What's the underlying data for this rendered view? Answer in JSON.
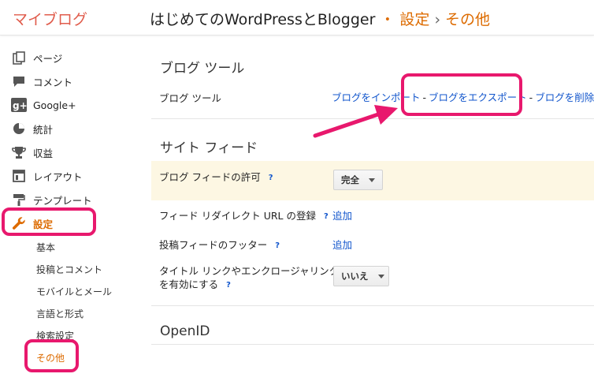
{
  "header": {
    "brand": "マイブログ",
    "blog_name": "はじめてのWordPressとBlogger",
    "sep1": "・",
    "section": "設定",
    "sep2": "›",
    "page": "その他"
  },
  "sidebar": {
    "items": [
      {
        "label": "ページ",
        "icon": "pages-icon"
      },
      {
        "label": "コメント",
        "icon": "comment-icon"
      },
      {
        "label": "Google+",
        "icon": "google-plus-icon"
      },
      {
        "label": "統計",
        "icon": "stats-pie-icon"
      },
      {
        "label": "収益",
        "icon": "trophy-icon"
      },
      {
        "label": "レイアウト",
        "icon": "layout-icon"
      },
      {
        "label": "テンプレート",
        "icon": "paint-roller-icon"
      },
      {
        "label": "設定",
        "icon": "wrench-icon"
      }
    ],
    "sub_items": [
      "基本",
      "投稿とコメント",
      "モバイルとメール",
      "言語と形式",
      "検索設定",
      "その他"
    ]
  },
  "main": {
    "blog_tools_title": "ブログ ツール",
    "blog_tools_label": "ブログ ツール",
    "import_link": "ブログをインポート",
    "export_link": "ブログをエクスポート",
    "delete_link": "ブログを削除",
    "dash": "-",
    "site_feed_title": "サイト フィード",
    "feed_allow_label": "ブログ フィードの許可",
    "feed_allow_value": "完全",
    "feed_redirect_label": "フィード リダイレクト URL の登録",
    "feed_footer_label": "投稿フィードのフッター",
    "title_link_label_1": "タイトル リンクやエンクロージャリンク",
    "title_link_label_2": "を有効にする",
    "title_link_value": "いいえ",
    "add_link": "追加",
    "help": "?",
    "openid_title": "OpenID"
  },
  "colors": {
    "accent_orange": "#dd6b00",
    "highlight_pink": "#e8186d",
    "link_blue": "#1155cc"
  }
}
